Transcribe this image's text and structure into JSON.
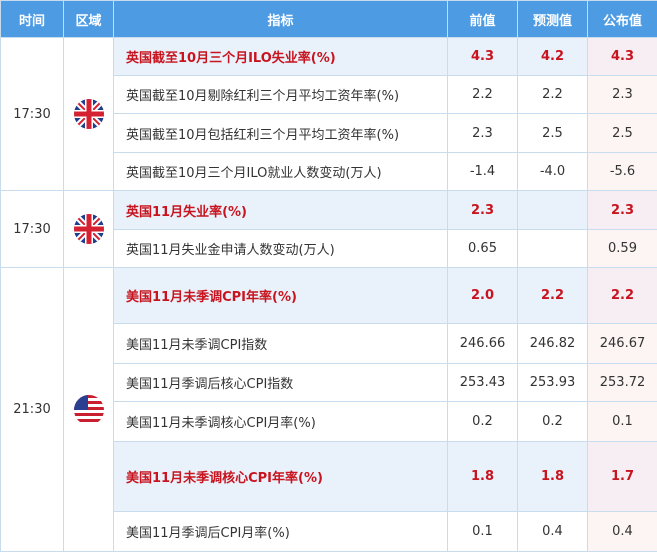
{
  "header": {
    "time": "时间",
    "region": "区域",
    "indicator": "指标",
    "previous": "前值",
    "forecast": "预测值",
    "actual": "公布值"
  },
  "groups": [
    {
      "time": "17:30",
      "region_icon": "uk-flag-icon",
      "rows": [
        {
          "indicator": "英国截至10月三个月ILO失业率(%)",
          "previous": "4.3",
          "forecast": "4.2",
          "actual": "4.3",
          "important": true
        },
        {
          "indicator": "英国截至10月剔除红利三个月平均工资年率(%)",
          "previous": "2.2",
          "forecast": "2.2",
          "actual": "2.3",
          "important": false
        },
        {
          "indicator": "英国截至10月包括红利三个月平均工资年率(%)",
          "previous": "2.3",
          "forecast": "2.5",
          "actual": "2.5",
          "important": false
        },
        {
          "indicator": "英国截至10月三个月ILO就业人数变动(万人)",
          "previous": "-1.4",
          "forecast": "-4.0",
          "actual": "-5.6",
          "important": false
        }
      ]
    },
    {
      "time": "17:30",
      "region_icon": "uk-flag-icon",
      "rows": [
        {
          "indicator": "英国11月失业率(%)",
          "previous": "2.3",
          "forecast": "",
          "actual": "2.3",
          "important": true
        },
        {
          "indicator": "英国11月失业金申请人数变动(万人)",
          "previous": "0.65",
          "forecast": "",
          "actual": "0.59",
          "important": false
        }
      ]
    },
    {
      "time": "21:30",
      "region_icon": "us-flag-icon",
      "rows": [
        {
          "indicator": "美国11月未季调CPI年率(%)",
          "previous": "2.0",
          "forecast": "2.2",
          "actual": "2.2",
          "important": true
        },
        {
          "indicator": "美国11月未季调CPI指数",
          "previous": "246.66",
          "forecast": "246.82",
          "actual": "246.67",
          "important": false
        },
        {
          "indicator": "美国11月季调后核心CPI指数",
          "previous": "253.43",
          "forecast": "253.93",
          "actual": "253.72",
          "important": false
        },
        {
          "indicator": "美国11月未季调核心CPI月率(%)",
          "previous": "0.2",
          "forecast": "0.2",
          "actual": "0.1",
          "important": false
        },
        {
          "indicator": "美国11月未季调核心CPI年率(%)",
          "previous": "1.8",
          "forecast": "1.8",
          "actual": "1.7",
          "important": true
        },
        {
          "indicator": "美国11月季调后CPI月率(%)",
          "previous": "0.1",
          "forecast": "0.4",
          "actual": "0.4",
          "important": false
        }
      ]
    }
  ]
}
